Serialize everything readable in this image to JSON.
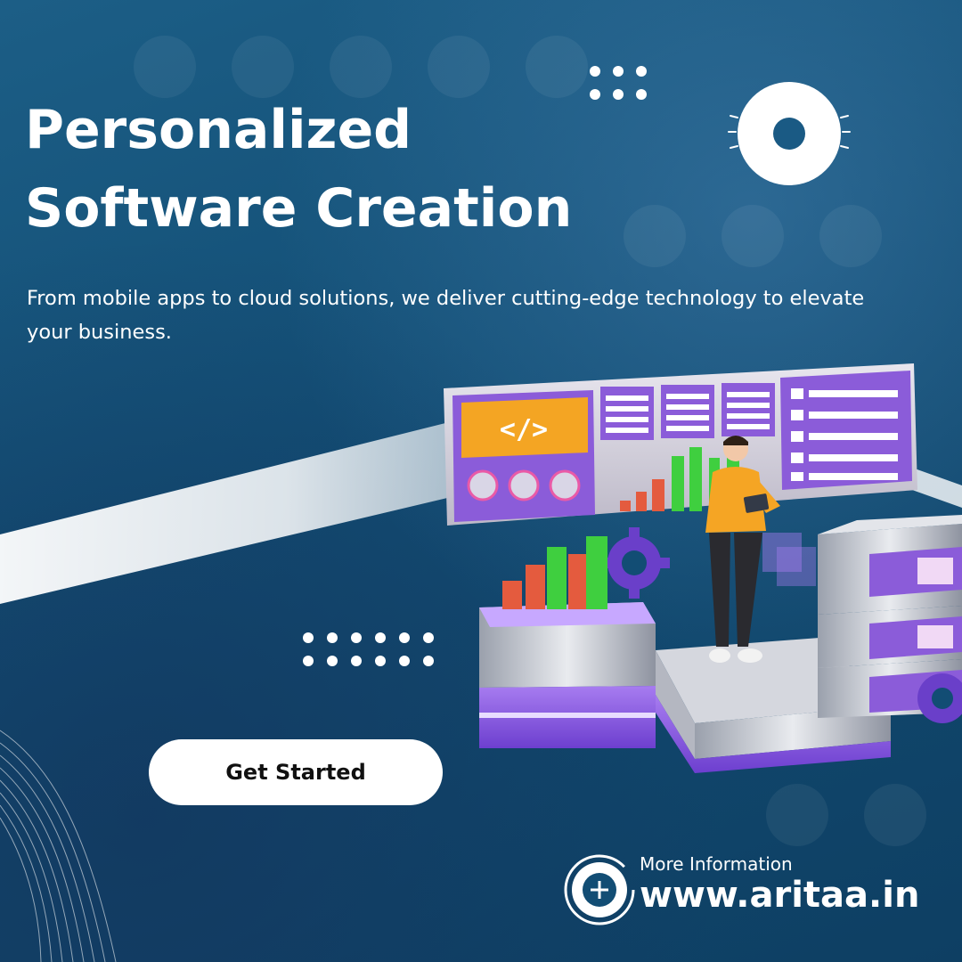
{
  "headline": {
    "line1": "Personalized",
    "line2": "Software Creation"
  },
  "subtitle": "From mobile apps to cloud solutions, we deliver cutting-edge technology to elevate your business.",
  "cta": {
    "label": "Get Started"
  },
  "footer": {
    "more_label": "More Information",
    "website": "www.aritaa.in",
    "plus_icon": "plus-icon"
  },
  "illustration": {
    "code_tag": "</>"
  },
  "colors": {
    "background": "#124d74",
    "text": "#ffffff",
    "button_bg": "#ffffff",
    "button_text": "#111111",
    "accent_purple": "#8c5ce0",
    "accent_orange": "#f5a524",
    "bar_green": "#3fcf3f",
    "bar_red": "#e45b3e"
  }
}
